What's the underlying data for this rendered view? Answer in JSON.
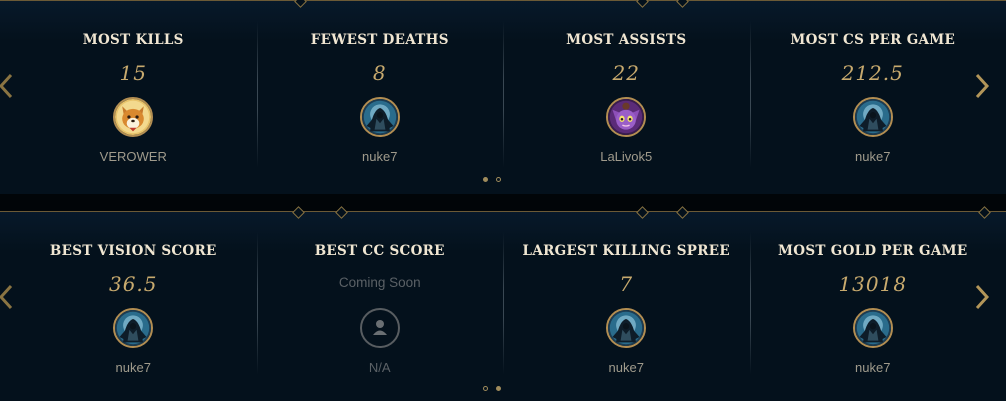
{
  "top_panel": {
    "cards": [
      {
        "label": "MOST KILLS",
        "value": "15",
        "player": "VEROWER",
        "avatar": "corgi-icon"
      },
      {
        "label": "FEWEST DEATHS",
        "value": "8",
        "player": "nuke7",
        "avatar": "hooded-champion-icon"
      },
      {
        "label": "MOST ASSISTS",
        "value": "22",
        "player": "LaLivok5",
        "avatar": "purple-yordle-icon"
      },
      {
        "label": "MOST CS PER GAME",
        "value": "212.5",
        "player": "nuke7",
        "avatar": "hooded-champion-icon"
      }
    ],
    "page_indicator": {
      "current": 1,
      "total": 2
    }
  },
  "bottom_panel": {
    "cards": [
      {
        "label": "BEST VISION SCORE",
        "value": "36.5",
        "player": "nuke7",
        "avatar": "hooded-champion-icon"
      },
      {
        "label": "BEST CC SCORE",
        "value": "Coming Soon",
        "player": "N/A",
        "avatar": "user-placeholder-icon"
      },
      {
        "label": "LARGEST KILLING SPREE",
        "value": "7",
        "player": "nuke7",
        "avatar": "hooded-champion-icon"
      },
      {
        "label": "MOST GOLD PER GAME",
        "value": "13018",
        "player": "nuke7",
        "avatar": "hooded-champion-icon"
      }
    ],
    "page_indicator": {
      "current": 2,
      "total": 2
    }
  },
  "colors": {
    "panel_bg": "#04111c",
    "gold": "#c8aa6e",
    "label_text": "#f0e6d2",
    "player_text": "#a09b8c",
    "avatar_ring": "#b38e52"
  }
}
